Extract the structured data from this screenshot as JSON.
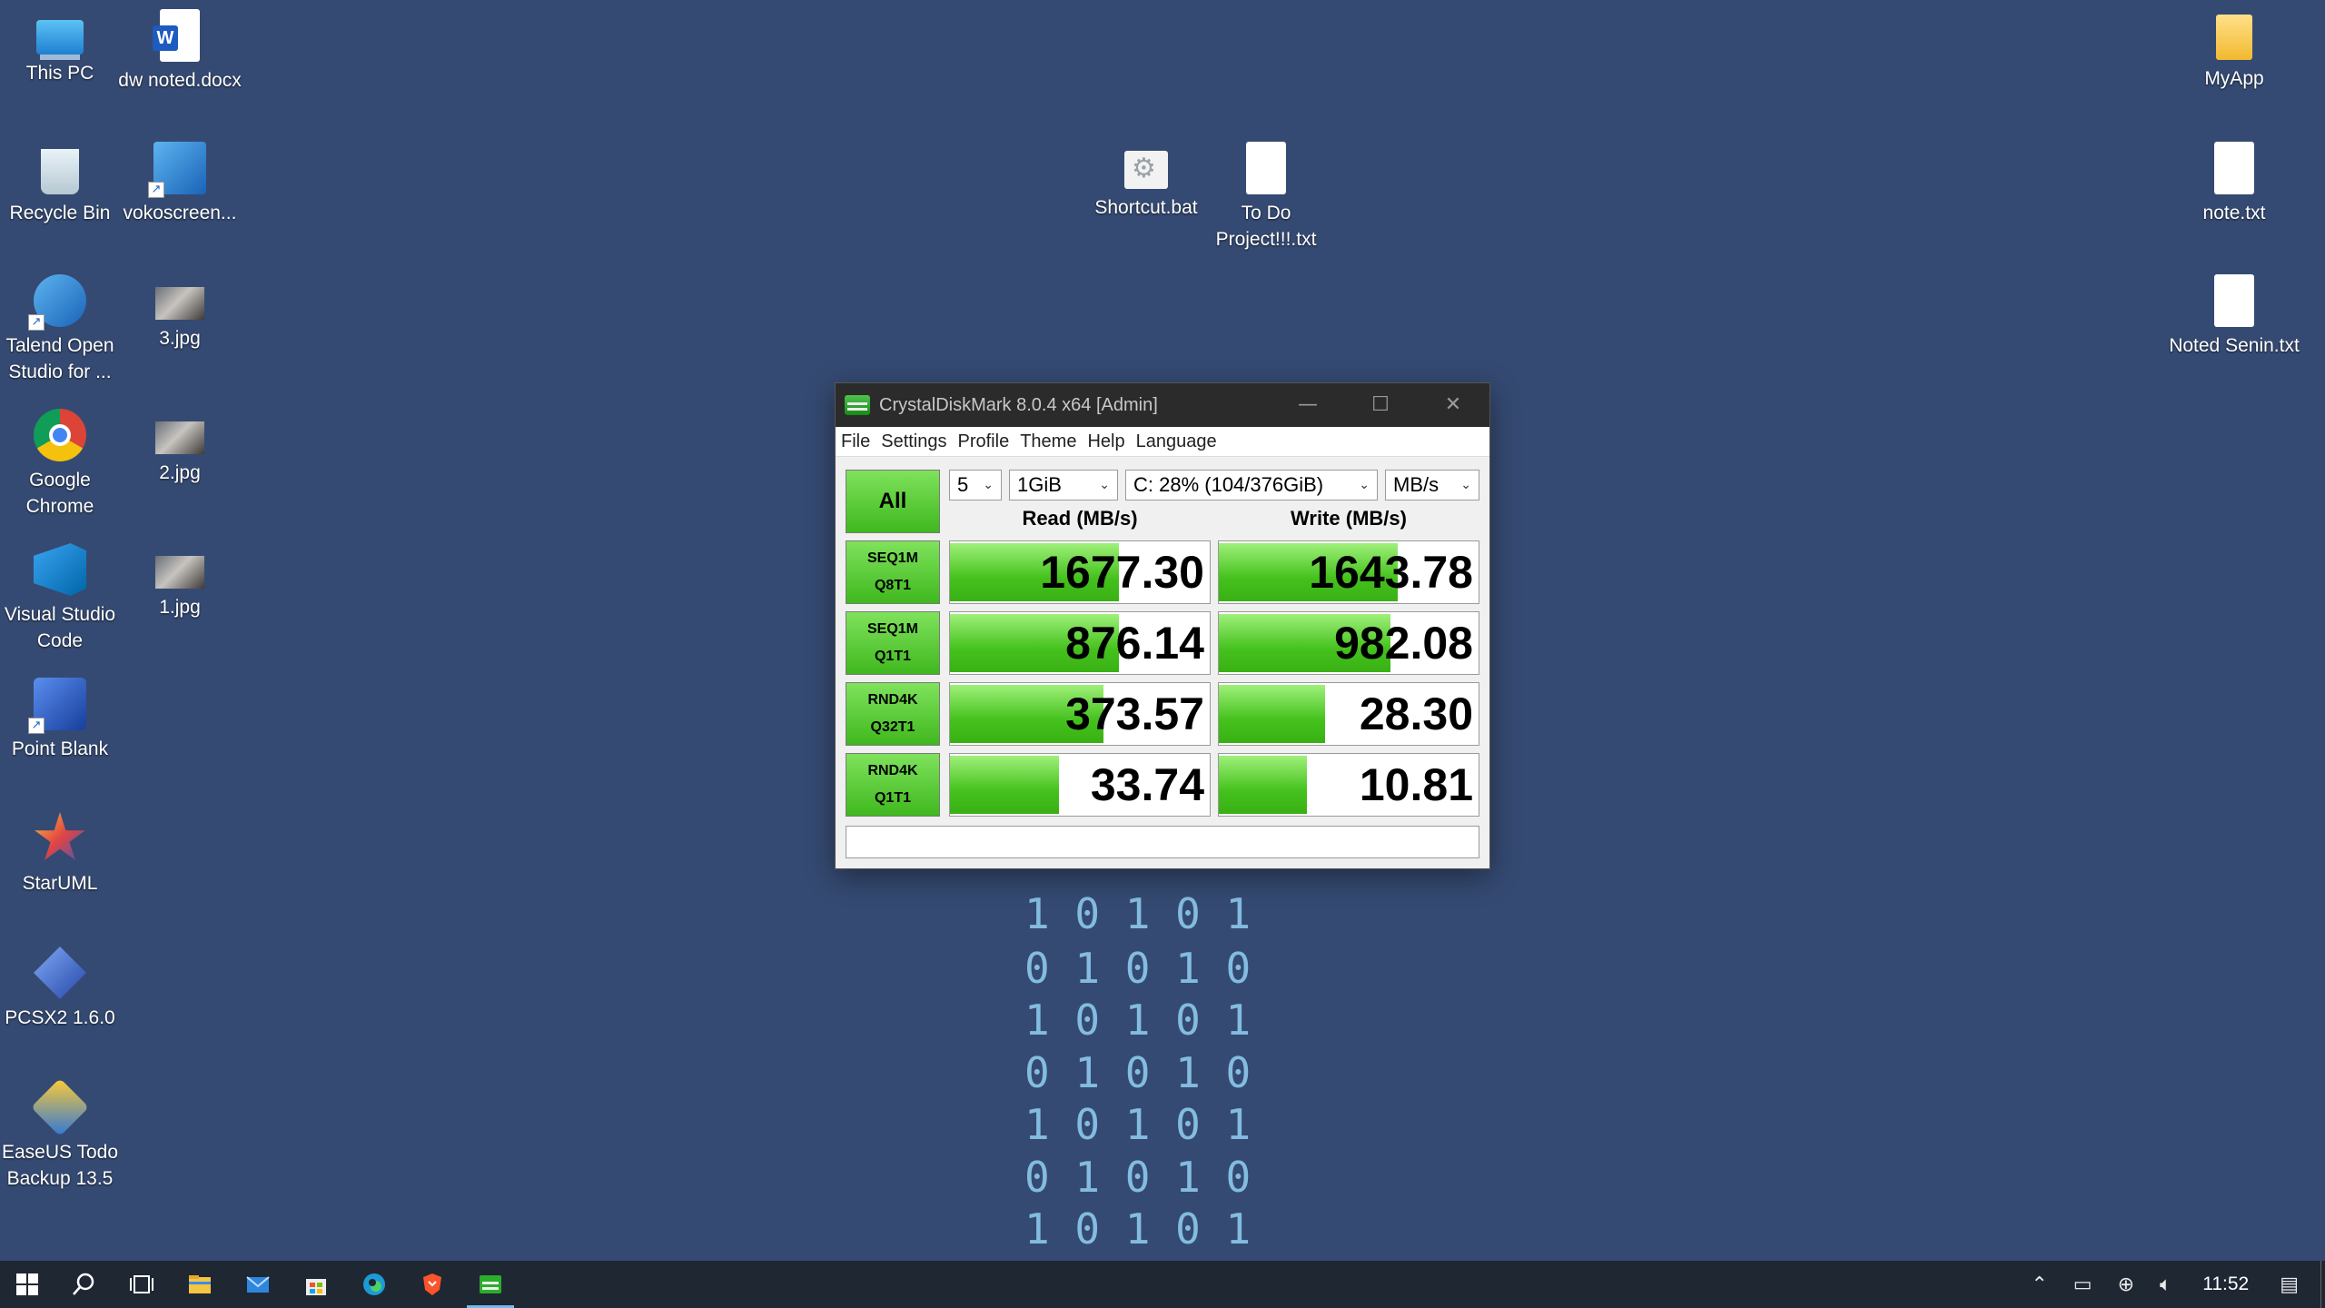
{
  "desktop": {
    "icons": [
      {
        "label": "This PC",
        "icon": "computer-icon"
      },
      {
        "label": "Recycle Bin",
        "icon": "recycle-bin-icon"
      },
      {
        "label": "Talend Open Studio for ...",
        "icon": "talend-icon"
      },
      {
        "label": "Google Chrome",
        "icon": "chrome-icon"
      },
      {
        "label": "Visual Studio Code",
        "icon": "vscode-icon"
      },
      {
        "label": "Point Blank",
        "icon": "point-blank-icon"
      },
      {
        "label": "StarUML",
        "icon": "staruml-icon"
      },
      {
        "label": "PCSX2 1.6.0",
        "icon": "pcsx2-icon"
      },
      {
        "label": "EaseUS Todo Backup 13.5",
        "icon": "easeus-icon"
      },
      {
        "label": "dw noted.docx",
        "icon": "word-document-icon"
      },
      {
        "label": "vokoscreen...",
        "icon": "vokoscreen-icon"
      },
      {
        "label": "3.jpg",
        "icon": "image-file-icon"
      },
      {
        "label": "2.jpg",
        "icon": "image-file-icon"
      },
      {
        "label": "1.jpg",
        "icon": "image-file-icon"
      },
      {
        "label": "Shortcut.bat",
        "icon": "batch-file-icon"
      },
      {
        "label": "To Do Project!!!.txt",
        "icon": "text-file-icon"
      },
      {
        "label": "MyApp",
        "icon": "folder-icon"
      },
      {
        "label": "note.txt",
        "icon": "text-file-icon"
      },
      {
        "label": "Noted Senin.txt",
        "icon": "text-file-icon"
      }
    ],
    "wallpaper_binary": [
      "1 0 1 0 1",
      "0 1 0 1 0",
      "1 0 1 0 1",
      "0 1 0 1 0",
      "1 0 1 0 1",
      "0 1 0 1 0",
      "1 0 1 0 1"
    ]
  },
  "window": {
    "title": "CrystalDiskMark 8.0.4 x64 [Admin]",
    "controls": {
      "minimize": "—",
      "maximize": "☐",
      "close": "✕"
    },
    "menu": [
      "File",
      "Settings",
      "Profile",
      "Theme",
      "Help",
      "Language"
    ],
    "all_button": "All",
    "selects": {
      "count": "5",
      "size": "1GiB",
      "drive": "C: 28% (104/376GiB)",
      "unit": "MB/s"
    },
    "headers": {
      "read": "Read (MB/s)",
      "write": "Write (MB/s)"
    },
    "rows": [
      {
        "line1": "SEQ1M",
        "line2": "Q8T1",
        "read": "1677.30",
        "write": "1643.78",
        "read_fill": 0.65,
        "write_fill": 0.69
      },
      {
        "line1": "SEQ1M",
        "line2": "Q1T1",
        "read": "876.14",
        "write": "982.08",
        "read_fill": 0.65,
        "write_fill": 0.66
      },
      {
        "line1": "RND4K",
        "line2": "Q32T1",
        "read": "373.57",
        "write": "28.30",
        "read_fill": 0.59,
        "write_fill": 0.41
      },
      {
        "line1": "RND4K",
        "line2": "Q1T1",
        "read": "33.74",
        "write": "10.81",
        "read_fill": 0.42,
        "write_fill": 0.34
      }
    ],
    "status_text": ""
  },
  "taskbar": {
    "items": [
      "start-icon",
      "search-icon",
      "task-view-icon",
      "file-explorer-icon",
      "mail-icon",
      "store-icon",
      "edge-icon",
      "brave-icon",
      "crystaldiskmark-icon"
    ],
    "clock": "11:52"
  },
  "colors": {
    "desktop_bg": "#354a72",
    "bar_green": "#45c21d",
    "taskbar_bg": "#1f2733"
  }
}
